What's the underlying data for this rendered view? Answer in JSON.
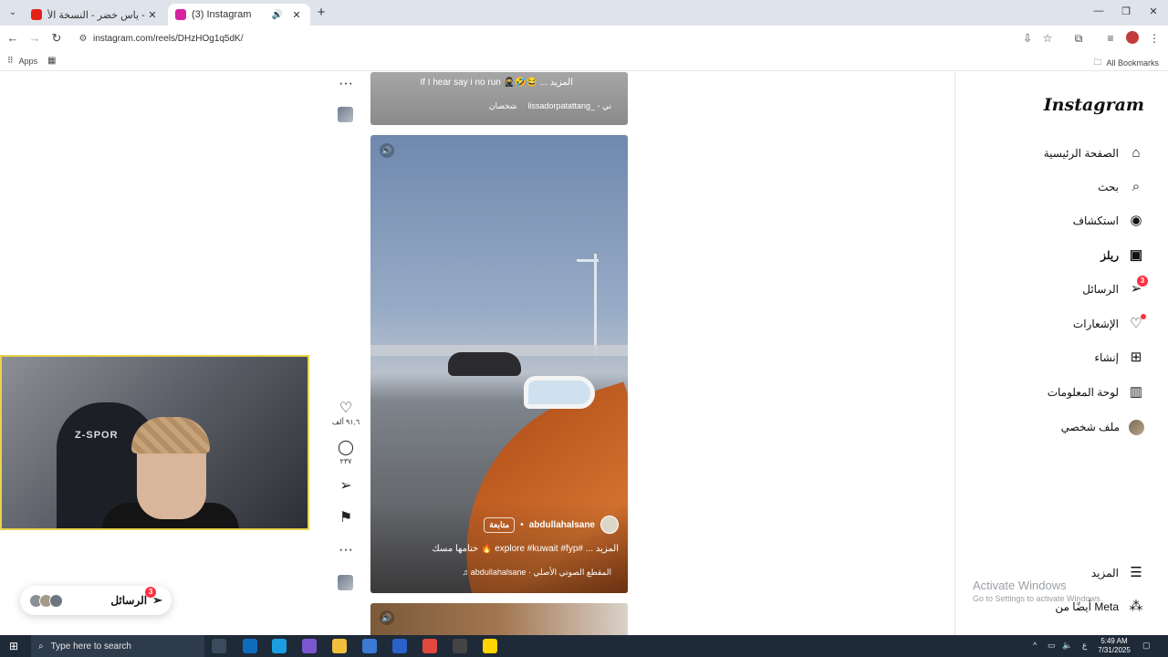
{
  "browser": {
    "tabs": [
      {
        "label": "اه يا ليل - ياس خضر - النسخة الأ",
        "icon_color": "#e62117",
        "active": false
      },
      {
        "label": "(3) Instagram",
        "icon_color": "#d6249f",
        "active": true
      }
    ],
    "url": "instagram.com/reels/DHzHOg1q5dK/",
    "bookmarks_apps": "Apps",
    "bookmarks_all": "All Bookmarks"
  },
  "feed": {
    "prev_reel": {
      "caption": "If I hear say i no run 🥷🤣😂 ... المزيد",
      "audio": "lissadorpatattang_ - تي",
      "tagged": "شخصان"
    },
    "current_reel": {
      "author": "abdullahalsane",
      "follow_label": "متابعة",
      "caption": "ختامها مسك 🔥 explore #kuwait #fyp# ... المزيد",
      "audio": "abdullahalsane · المقطع الصوتي الأصلي"
    },
    "actions": {
      "likes": "٩١,٦ ألف",
      "comments": "٢٣٧"
    }
  },
  "sidebar": {
    "logo": "Instagram",
    "items": [
      {
        "label": "الصفحة الرئيسية",
        "icon": "home-icon"
      },
      {
        "label": "بحث",
        "icon": "search-icon"
      },
      {
        "label": "استكشاف",
        "icon": "explore-icon"
      },
      {
        "label": "ريلز",
        "icon": "reels-icon"
      },
      {
        "label": "الرسائل",
        "icon": "messages-icon",
        "badge": "3"
      },
      {
        "label": "الإشعارات",
        "icon": "heart-icon"
      },
      {
        "label": "إنشاء",
        "icon": "create-icon"
      },
      {
        "label": "لوحة المعلومات",
        "icon": "dashboard-icon"
      },
      {
        "label": "ملف شخصي",
        "icon": "avatar"
      }
    ],
    "more": "المزيد",
    "also_from_meta": "أيضًا من Meta"
  },
  "messages_pill": {
    "label": "الرسائل",
    "badge": "3"
  },
  "watermark": {
    "line1": "Activate Windows",
    "line2": "Go to Settings to activate Windows."
  },
  "webcam": {
    "chair_brand": "Z-SPOR"
  },
  "taskbar": {
    "search_placeholder": "Type here to search",
    "time": "5:49 AM",
    "date": "7/31/2025",
    "lang": "ع"
  },
  "colors": {
    "accent": "#ff3040",
    "taskbar": "#1f2a38",
    "webcam_border": "#e9d34c"
  }
}
